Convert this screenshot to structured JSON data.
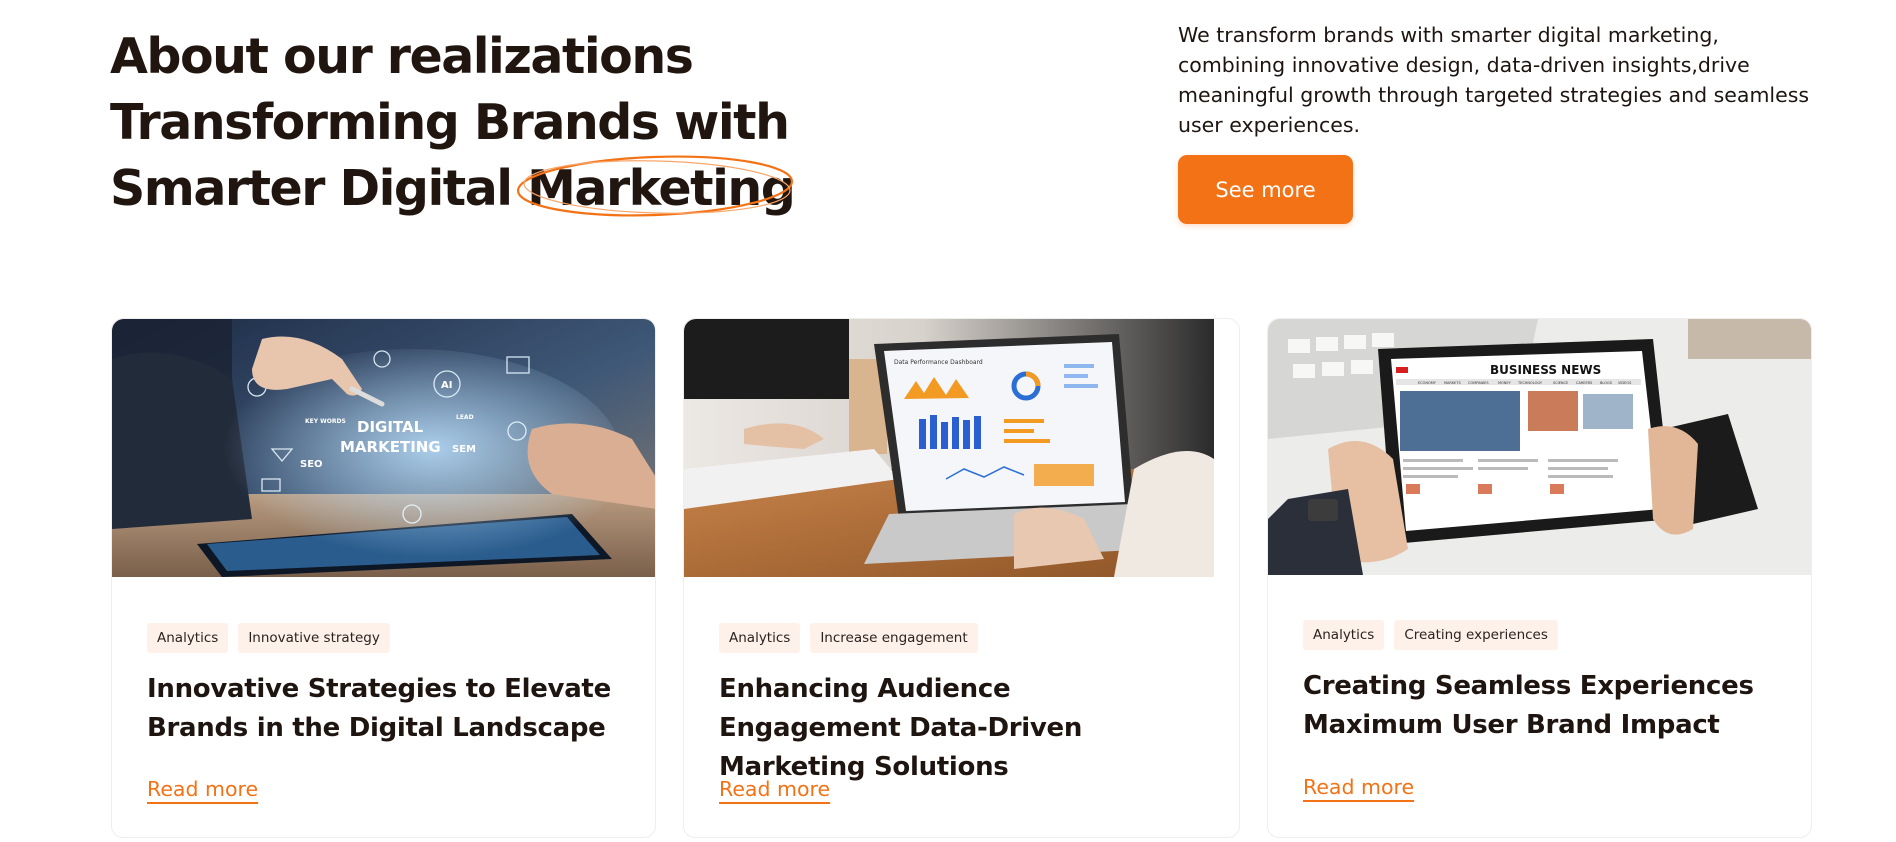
{
  "hero": {
    "title_line1": "About our realizations",
    "title_line2": "Transforming Brands with",
    "title_line3_prefix": "Smarter Digital ",
    "title_line3_highlight": "Marketing",
    "description": "We transform brands with smarter digital marketing, combining innovative design, data-driven insights,drive meaningful growth through targeted strategies and seamless user experiences.",
    "cta_label": "See more"
  },
  "cards": [
    {
      "image": {
        "overlay_text_1": "DIGITAL",
        "overlay_text_2": "MARKETING",
        "labels": [
          "SEO",
          "SEM",
          "AI",
          "KEY WORDS",
          "LEAD"
        ]
      },
      "tags": [
        "Analytics",
        "Innovative strategy"
      ],
      "title": "Innovative Strategies to Elevate Brands in the Digital Landscape",
      "link": "Read more"
    },
    {
      "image": {
        "screen_title": "Data Performance Dashboard"
      },
      "tags": [
        "Analytics",
        "Increase engagement"
      ],
      "title": "Enhancing Audience Engagement Data-Driven Marketing Solutions",
      "link": "Read more"
    },
    {
      "image": {
        "screen_title": "BUSINESS NEWS",
        "nav": [
          "ECONOMY",
          "MARKETS",
          "COMPANIES",
          "MONEY",
          "TECHNOLOGY",
          "SCIENCE",
          "CAREERS",
          "BLOGS",
          "VIDEOS"
        ]
      },
      "tags": [
        "Analytics",
        "Creating experiences"
      ],
      "title": "Creating Seamless Experiences Maximum User Brand Impact",
      "link": "Read more"
    }
  ],
  "colors": {
    "accent": "#f47216",
    "text": "#1e1410",
    "tag_bg": "#fdf1ea"
  }
}
